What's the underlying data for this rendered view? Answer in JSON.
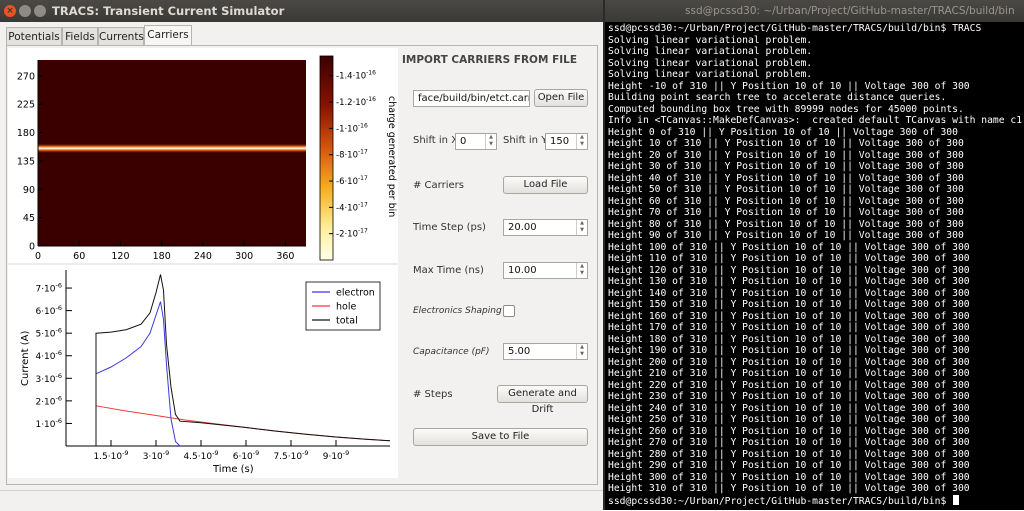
{
  "app": {
    "title": "TRACS: Transient Current Simulator",
    "close_glyph": "×",
    "tabs": [
      {
        "label": "Potentials"
      },
      {
        "label": "Fields"
      },
      {
        "label": "Currents"
      },
      {
        "label": "Carriers"
      }
    ],
    "active_tab": "Carriers"
  },
  "controls": {
    "import_heading": "IMPORT CARRIERS FROM FILE",
    "file_path": "face/build/bin/etct.carriers",
    "open_file_button": "Open File",
    "shift_x_label": "Shift in X",
    "shift_x_value": "0",
    "shift_y_label": "Shift in Y",
    "shift_y_value": "150",
    "carriers_label": "# Carriers",
    "load_file_button": "Load File",
    "time_step_label": "Time Step (ps)",
    "time_step_value": "20.00",
    "max_time_label": "Max Time (ns)",
    "max_time_value": "10.00",
    "electronics_shaping_label": "Electronics Shaping",
    "capacitance_label": "Capacitance (pF)",
    "capacitance_value": "5.00",
    "steps_label": "# Steps",
    "generate_button": "Generate and Drift",
    "save_button": "Save to File"
  },
  "chart_data": [
    {
      "type": "heatmap",
      "x_ticks": [
        "0",
        "60",
        "120",
        "180",
        "240",
        "300",
        "360"
      ],
      "y_ticks": [
        "0",
        "45",
        "90",
        "135",
        "180",
        "225",
        "270"
      ],
      "xlim": [
        0,
        390
      ],
      "ylim": [
        0,
        295
      ],
      "band_y": 155,
      "colorbar": {
        "label": "charge generated per bin",
        "ticks": [
          {
            "mant": "-2",
            "exp": "-17",
            "value": -2e-17
          },
          {
            "mant": "-4",
            "exp": "-17",
            "value": -4e-17
          },
          {
            "mant": "-6",
            "exp": "-17",
            "value": -6e-17
          },
          {
            "mant": "-8",
            "exp": "-17",
            "value": -8e-17
          },
          {
            "mant": "-1",
            "exp": "-16",
            "value": -1e-16
          },
          {
            "mant": "-1.2",
            "exp": "-16",
            "value": -1.2e-16
          },
          {
            "mant": "-1.4",
            "exp": "-16",
            "value": -1.4e-16
          }
        ],
        "range": [
          0,
          -1.55e-16
        ],
        "colors": {
          "low": "#ffffe8",
          "mid": "#e8a018",
          "high": "#3a0000"
        }
      }
    },
    {
      "type": "line",
      "xlabel": "Time (s)",
      "ylabel": "Current (A)",
      "xlim": [
        0,
        1.08e-08
      ],
      "ylim": [
        0,
        7.8e-06
      ],
      "x_ticks": [
        {
          "value": 1.5e-09,
          "mant": "1.5",
          "exp": "-9"
        },
        {
          "value": 3e-09,
          "mant": "3",
          "exp": "-9"
        },
        {
          "value": 4.5e-09,
          "mant": "4.5",
          "exp": "-9"
        },
        {
          "value": 6e-09,
          "mant": "6",
          "exp": "-9"
        },
        {
          "value": 7.5e-09,
          "mant": "7.5",
          "exp": "-9"
        },
        {
          "value": 9e-09,
          "mant": "9",
          "exp": "-9"
        }
      ],
      "y_ticks": [
        {
          "value": 1e-06,
          "mant": "1",
          "exp": "-6"
        },
        {
          "value": 2e-06,
          "mant": "2",
          "exp": "-6"
        },
        {
          "value": 3e-06,
          "mant": "3",
          "exp": "-6"
        },
        {
          "value": 4e-06,
          "mant": "4",
          "exp": "-6"
        },
        {
          "value": 5e-06,
          "mant": "5",
          "exp": "-6"
        },
        {
          "value": 6e-06,
          "mant": "6",
          "exp": "-6"
        },
        {
          "value": 7e-06,
          "mant": "7",
          "exp": "-6"
        }
      ],
      "legend_position": "top-right",
      "series": [
        {
          "name": "electron",
          "color": "#3b3bdd",
          "points": [
            [
              1e-09,
              0
            ],
            [
              1e-09,
              3.2e-06
            ],
            [
              1.5e-09,
              3.5e-06
            ],
            [
              2e-09,
              3.9e-06
            ],
            [
              2.5e-09,
              4.4e-06
            ],
            [
              2.8e-09,
              5e-06
            ],
            [
              3e-09,
              5.8e-06
            ],
            [
              3.15e-09,
              6.4e-06
            ],
            [
              3.25e-09,
              5.6e-06
            ],
            [
              3.35e-09,
              3.6e-06
            ],
            [
              3.5e-09,
              1.2e-06
            ],
            [
              3.65e-09,
              2e-07
            ],
            [
              3.8e-09,
              0
            ]
          ]
        },
        {
          "name": "hole",
          "color": "#ee3b3b",
          "points": [
            [
              1e-09,
              0
            ],
            [
              1e-09,
              1.78e-06
            ],
            [
              2e-09,
              1.55e-06
            ],
            [
              3e-09,
              1.35e-06
            ],
            [
              4e-09,
              1.15e-06
            ],
            [
              5e-09,
              9.8e-07
            ],
            [
              6e-09,
              8.2e-07
            ],
            [
              7e-09,
              6.6e-07
            ],
            [
              8e-09,
              5.2e-07
            ],
            [
              9e-09,
              4e-07
            ],
            [
              1e-08,
              3e-07
            ],
            [
              1.08e-08,
              2.3e-07
            ]
          ]
        },
        {
          "name": "total",
          "color": "#111111",
          "points": [
            [
              1e-09,
              0
            ],
            [
              1e-09,
              5e-06
            ],
            [
              1.5e-09,
              5.05e-06
            ],
            [
              2e-09,
              5.15e-06
            ],
            [
              2.5e-09,
              5.4e-06
            ],
            [
              2.8e-09,
              5.9e-06
            ],
            [
              3e-09,
              6.8e-06
            ],
            [
              3.15e-09,
              7.6e-06
            ],
            [
              3.25e-09,
              6.9e-06
            ],
            [
              3.35e-09,
              4.5e-06
            ],
            [
              3.5e-09,
              2.6e-06
            ],
            [
              3.65e-09,
              1.4e-06
            ],
            [
              3.8e-09,
              1.1e-06
            ],
            [
              4.5e-09,
              1.03e-06
            ],
            [
              6e-09,
              8.2e-07
            ],
            [
              7e-09,
              6.6e-07
            ],
            [
              8e-09,
              5.2e-07
            ],
            [
              9e-09,
              4e-07
            ],
            [
              1e-08,
              3e-07
            ],
            [
              1.08e-08,
              2.3e-07
            ]
          ]
        }
      ]
    }
  ],
  "terminal": {
    "title": "ssd@pcssd30: ~/Urban/Project/GitHub-master/TRACS/build/bin",
    "lines": [
      "ssd@pcssd30:~/Urban/Project/GitHub-master/TRACS/build/bin$ TRACS",
      "Solving linear variational problem.",
      "Solving linear variational problem.",
      "Solving linear variational problem.",
      "Solving linear variational problem.",
      "Height -10 of 310 || Y Position 10 of 10 || Voltage 300 of 300",
      "Building point search tree to accelerate distance queries.",
      "Computed bounding box tree with 89999 nodes for 45000 points.",
      "Info in <TCanvas::MakeDefCanvas>:  created default TCanvas with name c1",
      "Height 0 of 310 || Y Position 10 of 10 || Voltage 300 of 300",
      "Height 10 of 310 || Y Position 10 of 10 || Voltage 300 of 300",
      "Height 20 of 310 || Y Position 10 of 10 || Voltage 300 of 300",
      "Height 30 of 310 || Y Position 10 of 10 || Voltage 300 of 300",
      "Height 40 of 310 || Y Position 10 of 10 || Voltage 300 of 300",
      "Height 50 of 310 || Y Position 10 of 10 || Voltage 300 of 300",
      "Height 60 of 310 || Y Position 10 of 10 || Voltage 300 of 300",
      "Height 70 of 310 || Y Position 10 of 10 || Voltage 300 of 300",
      "Height 80 of 310 || Y Position 10 of 10 || Voltage 300 of 300",
      "Height 90 of 310 || Y Position 10 of 10 || Voltage 300 of 300",
      "Height 100 of 310 || Y Position 10 of 10 || Voltage 300 of 300",
      "Height 110 of 310 || Y Position 10 of 10 || Voltage 300 of 300",
      "Height 120 of 310 || Y Position 10 of 10 || Voltage 300 of 300",
      "Height 130 of 310 || Y Position 10 of 10 || Voltage 300 of 300",
      "Height 140 of 310 || Y Position 10 of 10 || Voltage 300 of 300",
      "Height 150 of 310 || Y Position 10 of 10 || Voltage 300 of 300",
      "Height 160 of 310 || Y Position 10 of 10 || Voltage 300 of 300",
      "Height 170 of 310 || Y Position 10 of 10 || Voltage 300 of 300",
      "Height 180 of 310 || Y Position 10 of 10 || Voltage 300 of 300",
      "Height 190 of 310 || Y Position 10 of 10 || Voltage 300 of 300",
      "Height 200 of 310 || Y Position 10 of 10 || Voltage 300 of 300",
      "Height 210 of 310 || Y Position 10 of 10 || Voltage 300 of 300",
      "Height 220 of 310 || Y Position 10 of 10 || Voltage 300 of 300",
      "Height 230 of 310 || Y Position 10 of 10 || Voltage 300 of 300",
      "Height 240 of 310 || Y Position 10 of 10 || Voltage 300 of 300",
      "Height 250 of 310 || Y Position 10 of 10 || Voltage 300 of 300",
      "Height 260 of 310 || Y Position 10 of 10 || Voltage 300 of 300",
      "Height 270 of 310 || Y Position 10 of 10 || Voltage 300 of 300",
      "Height 280 of 310 || Y Position 10 of 10 || Voltage 300 of 300",
      "Height 290 of 310 || Y Position 10 of 10 || Voltage 300 of 300",
      "Height 300 of 310 || Y Position 10 of 10 || Voltage 300 of 300",
      "Height 310 of 310 || Y Position 10 of 10 || Voltage 300 of 300"
    ],
    "prompt": "ssd@pcssd30:~/Urban/Project/GitHub-master/TRACS/build/bin$ "
  }
}
